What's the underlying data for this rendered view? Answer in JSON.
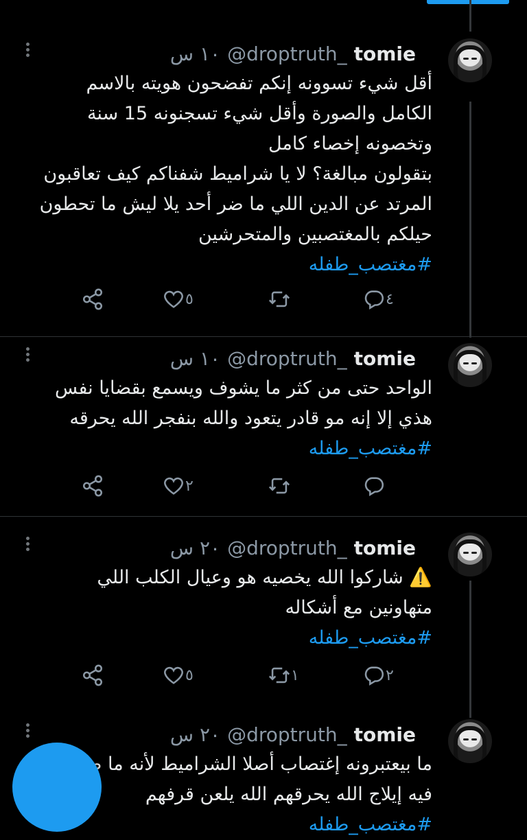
{
  "tweets": [
    {
      "name": "tomie",
      "handle": "@droptruth_",
      "time": "١٠ س",
      "lines": [
        "أقل شيء تسوونه إنكم تفضحون هويته بالاسم",
        "الكامل والصورة وأقل شيء تسجنونه 15 سنة",
        "وتخصونه إخصاء كامل",
        "بتقولون مبالغة؟ لا يا شراميط شفناكم كيف تعاقبون",
        "المرتد عن الدين اللي ما ضر أحد يلا ليش ما تحطون",
        "حيلكم بالمغتصبين والمتحرشين"
      ],
      "hashtag": "#مغتصب_طفله",
      "replies": "٤",
      "retweets": "",
      "likes": "٥"
    },
    {
      "name": "tomie",
      "handle": "@droptruth_",
      "time": "١٠ س",
      "lines": [
        "الواحد حتى من كثر ما يشوف ويسمع بقضايا نفس",
        "هذي إلا إنه مو قادر يتعود والله بنفجر الله يحرقه"
      ],
      "hashtag": "#مغتصب_طفله",
      "replies": "",
      "retweets": "",
      "likes": "٢"
    },
    {
      "name": "tomie",
      "handle": "@droptruth_",
      "time": "٢٠ س",
      "lines": [
        "⚠️ شاركوا الله يخصيه هو وعيال الكلب اللي",
        "متهاونين مع أشكاله"
      ],
      "hashtag": "#مغتصب_طفله",
      "replies": "٢",
      "retweets": "١",
      "likes": "٥"
    },
    {
      "name": "tomie",
      "handle": "@droptruth_",
      "time": "٢٠ س",
      "lines": [
        "ما بيعتبرونه إغتصاب أصلا الشراميط لأنه ما صار",
        "فيه إيلاج الله يحرقهم الله يلعن قرفهم"
      ],
      "hashtag": "#مغتصب_طفله"
    }
  ],
  "icons": {
    "reply": "reply-icon",
    "retweet": "retweet-icon",
    "like": "heart-icon",
    "share": "share-icon",
    "more": "more-options-icon"
  },
  "colors": {
    "background": "#000000",
    "text": "#e7e9ea",
    "muted": "#8b98a5",
    "accent": "#1d9bf0"
  }
}
